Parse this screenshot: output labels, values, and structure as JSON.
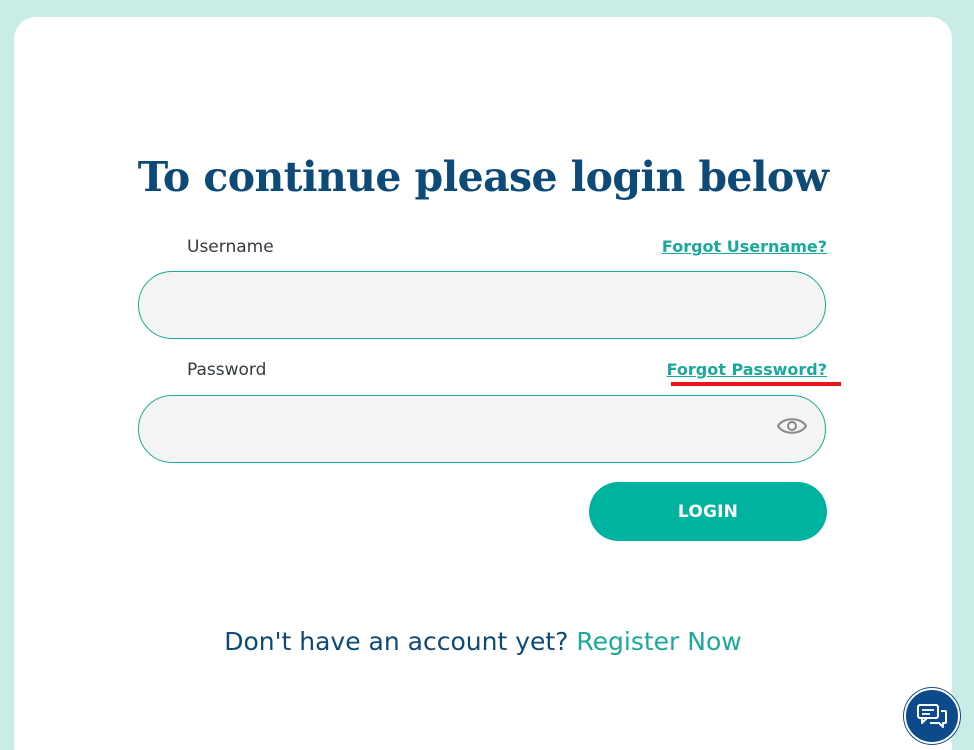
{
  "login": {
    "title": "To continue please login below",
    "username_label": "Username",
    "forgot_username": "Forgot Username?",
    "username_value": "",
    "password_label": "Password",
    "forgot_password": "Forgot Password?",
    "password_value": "",
    "login_button": "LOGIN"
  },
  "register": {
    "prompt": "Don't have an account yet?",
    "link": "Register Now"
  },
  "icons": {
    "password_toggle": "eye-icon",
    "chat": "chat-bubbles-icon"
  },
  "colors": {
    "brand_navy": "#0d4a78",
    "accent_teal": "#00b3a0",
    "link_teal": "#1aa99a",
    "highlight_red": "#e8141c",
    "background": "#c9ece6"
  }
}
